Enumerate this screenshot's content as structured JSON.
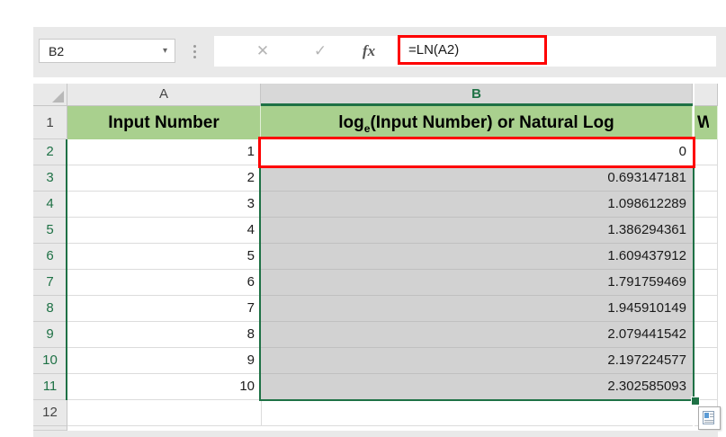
{
  "name_box": {
    "value": "B2",
    "caret_icon": "▾"
  },
  "formula_bar": {
    "cancel_icon": "✕",
    "enter_icon": "✓",
    "fx_label": "fx",
    "formula": "=LN(A2)"
  },
  "sheet": {
    "col_headers": {
      "a": "A",
      "b": "B"
    },
    "header_row": {
      "a1": "Input Number",
      "b1_prefix": "log",
      "b1_sub": "e",
      "b1_suffix": "(Input Number) or Natural Log",
      "c1_partial": "W"
    },
    "row_numbers": [
      "1",
      "2",
      "3",
      "4",
      "5",
      "6",
      "7",
      "8",
      "9",
      "10",
      "11",
      "12"
    ],
    "rows": [
      {
        "a": "1",
        "b": "0"
      },
      {
        "a": "2",
        "b": "0.693147181"
      },
      {
        "a": "3",
        "b": "1.098612289"
      },
      {
        "a": "4",
        "b": "1.386294361"
      },
      {
        "a": "5",
        "b": "1.609437912"
      },
      {
        "a": "6",
        "b": "1.791759469"
      },
      {
        "a": "7",
        "b": "1.945910149"
      },
      {
        "a": "8",
        "b": "2.079441542"
      },
      {
        "a": "9",
        "b": "2.197224577"
      },
      {
        "a": "10",
        "b": "2.302585093"
      }
    ],
    "selected_range": "B2:B11",
    "active_cell": "B2"
  },
  "colors": {
    "accent_green": "#1e7145",
    "header_fill_green": "#a9d08e",
    "selection_fill": "#d2d2d2",
    "annotation_red": "#fe0000"
  }
}
